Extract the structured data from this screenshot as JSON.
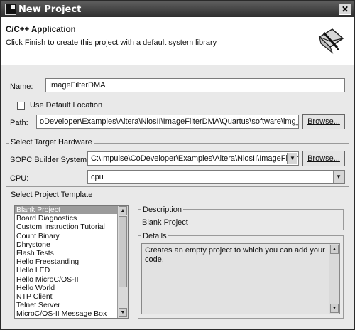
{
  "window": {
    "title": "New Project",
    "close_label": "✕"
  },
  "banner": {
    "title": "C/C++ Application",
    "subtitle": "Click Finish to create this project with a default system library"
  },
  "name": {
    "label": "Name:",
    "value": "ImageFilterDMA"
  },
  "location": {
    "use_default_label": "Use Default Location",
    "use_default_checked": false,
    "path_label": "Path:",
    "path_value": "oDeveloper\\Examples\\Altera\\NiosII\\ImageFilterDMA\\Quartus\\software\\img_arch",
    "browse_label": "Browse..."
  },
  "hardware": {
    "group_title": "Select Target Hardware",
    "sopc_label": "SOPC Builder System:",
    "sopc_value": "C:\\Impulse\\CoDeveloper\\Examples\\Altera\\NiosII\\ImageFilterD",
    "browse_label": "Browse...",
    "cpu_label": "CPU:",
    "cpu_value": "cpu"
  },
  "template": {
    "group_title": "Select Project Template",
    "items": [
      "Blank Project",
      "Board Diagnostics",
      "Custom Instruction Tutorial",
      "Count Binary",
      "Dhrystone",
      "Flash Tests",
      "Hello Freestanding",
      "Hello LED",
      "Hello MicroC/OS-II",
      "Hello World",
      "NTP Client",
      "Telnet Server",
      "MicroC/OS-II Message Box"
    ],
    "selected_index": 0,
    "description_title": "Description",
    "description_value": "Blank Project",
    "details_title": "Details",
    "details_value": "Creates an empty project to which you can add your code."
  }
}
